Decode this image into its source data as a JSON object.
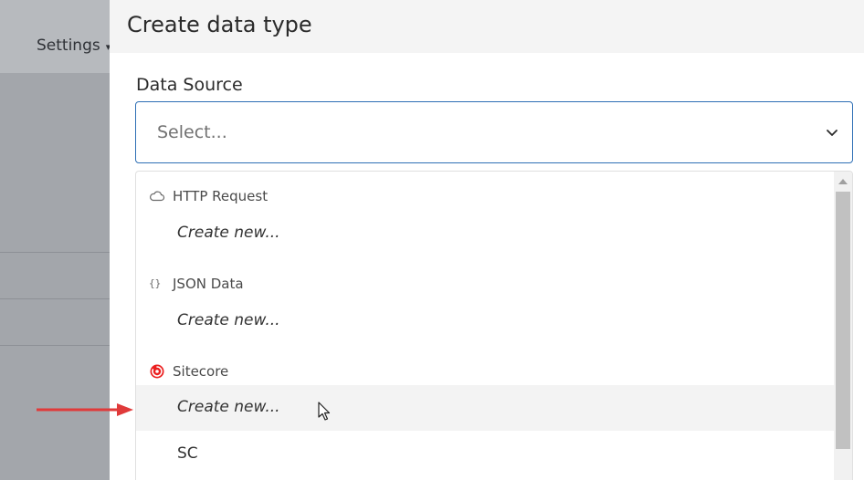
{
  "background": {
    "settings_label": "Settings"
  },
  "panel": {
    "title": "Create data type",
    "field_label": "Data Source",
    "select": {
      "placeholder": "Select..."
    }
  },
  "menu": {
    "groups": [
      {
        "label": "HTTP Request",
        "icon": "cloud-icon",
        "options": [
          {
            "label": "Create new..."
          }
        ]
      },
      {
        "label": "JSON Data",
        "icon": "json-braces-icon",
        "icon_text": "{}",
        "options": [
          {
            "label": "Create new..."
          }
        ]
      },
      {
        "label": "Sitecore",
        "icon": "sitecore-logo-icon",
        "icon_color": "#eb1f1f",
        "options": [
          {
            "label": "Create new..."
          },
          {
            "label": "SC"
          }
        ]
      }
    ]
  },
  "colors": {
    "accent_border": "#2e6fb5",
    "annotation_arrow": "#e03a3a"
  }
}
